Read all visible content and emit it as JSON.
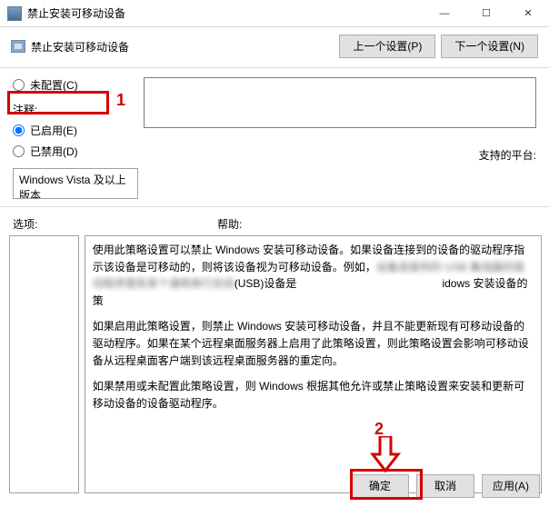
{
  "window": {
    "title": "禁止安装可移动设备"
  },
  "win_controls": {
    "min": "—",
    "max": "☐",
    "close": "✕"
  },
  "header": {
    "setting_name": "禁止安装可移动设备",
    "prev_label": "上一个设置(P)",
    "next_label": "下一个设置(N)"
  },
  "radios": {
    "not_configured": "未配置(C)",
    "enabled": "已启用(E)",
    "disabled": "已禁用(D)"
  },
  "labels": {
    "comment": "注释:",
    "supported": "支持的平台:",
    "options": "选项:",
    "help": "帮助:"
  },
  "comment_value": "",
  "supported_on": "Windows Vista 及以上版本",
  "help_text": {
    "p1a": "使用此策略设置可以禁止 Windows 安装可移动设备。如果设备连接到的设备的驱动程序指示该设备是可移动的，则将该设备视为可移动设备。例如，",
    "p1b": "设备连接到的 USB 集线器的驱动程序报告某个通用串行总线",
    "p1c": "(USB)设备是",
    "p1d": "                                                ",
    "p1e": "idows 安装设备的策",
    "p2": "如果启用此策略设置，则禁止 Windows 安装可移动设备，并且不能更新现有可移动设备的驱动程序。如果在某个远程桌面服务器上启用了此策略设置，则此策略设置会影响可移动设备从远程桌面客户端到该远程桌面服务器的重定向。",
    "p3": "如果禁用或未配置此策略设置，则 Windows 根据其他允许或禁止策略设置来安装和更新可移动设备的设备驱动程序。"
  },
  "footer": {
    "ok": "确定",
    "cancel": "取消",
    "apply": "应用(A)"
  },
  "annotations": {
    "one": "1",
    "two": "2"
  }
}
